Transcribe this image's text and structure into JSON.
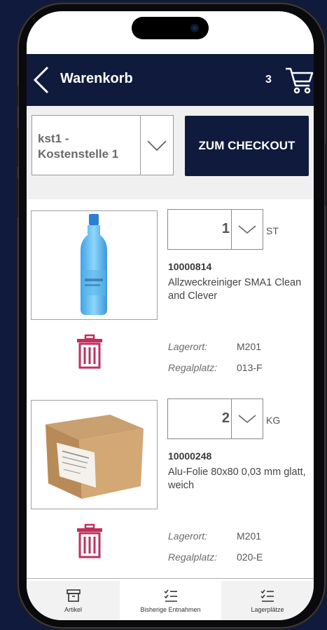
{
  "header": {
    "title": "Warenkorb",
    "cart_count": "3"
  },
  "cost_center": {
    "selected": "kst1 - Kostenstelle 1"
  },
  "checkout_label": "ZUM CHECKOUT",
  "items": [
    {
      "quantity": "1",
      "unit": "ST",
      "article_number": "10000814",
      "description": "Allzweckreiniger SMA1 Clean and Clever",
      "lagerort_label": "Lagerort:",
      "lagerort_value": "M201",
      "regalplatz_label": "Regalplatz:",
      "regalplatz_value": "013-F"
    },
    {
      "quantity": "2",
      "unit": "KG",
      "article_number": "10000248",
      "description": "Alu-Folie 80x80 0,03 mm glatt, weich",
      "lagerort_label": "Lagerort:",
      "lagerort_value": "M201",
      "regalplatz_label": "Regalplatz:",
      "regalplatz_value": "020-E"
    }
  ],
  "nav": [
    {
      "label": "Artikel",
      "icon": "archive-icon"
    },
    {
      "label": "Bisherige Entnahmen",
      "icon": "checklist-icon"
    },
    {
      "label": "Lagerplätze",
      "icon": "checklist-icon"
    }
  ],
  "colors": {
    "primary": "#0f1a3d",
    "trash": "#c0305d",
    "bar": "#f0f0f0"
  }
}
